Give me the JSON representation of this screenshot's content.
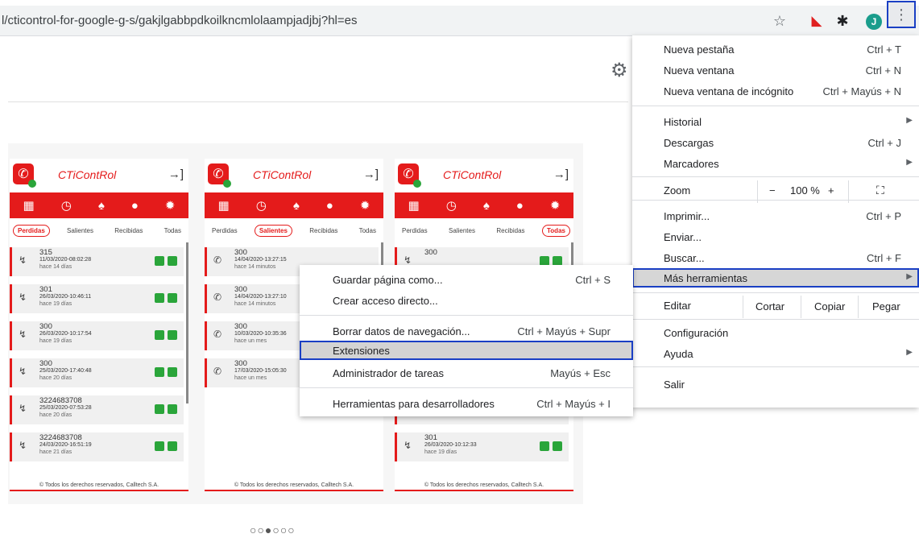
{
  "browser": {
    "url": "l/cticontrol-for-google-g-s/gakjlgabbpdkoilkncmlolaampjadjbj?hl=es",
    "avatar_letter": "J",
    "icons": [
      "star-icon",
      "extension-red-icon",
      "puzzle-icon",
      "avatar",
      "kebab-menu-icon"
    ]
  },
  "pagination_dots": "○○●○○○",
  "app": {
    "brand": "CTiContRol",
    "tabs": [
      "Perdidas",
      "Salientes",
      "Recibidas",
      "Todas"
    ],
    "footer": "© Todos los derechos reservados, Calltech S.A."
  },
  "cards": [
    {
      "active_tab": 0,
      "calls": [
        {
          "number": "315",
          "datetime": "11/03/2020-08:02:28",
          "ago": "hace 14 días"
        },
        {
          "number": "301",
          "datetime": "26/03/2020-10:46:11",
          "ago": "hace 19 días"
        },
        {
          "number": "300",
          "datetime": "26/03/2020-10:17:54",
          "ago": "hace 19 días"
        },
        {
          "number": "300",
          "datetime": "25/03/2020-17:40:48",
          "ago": "hace 20 días"
        },
        {
          "number": "3224683708",
          "datetime": "25/03/2020-07:53:28",
          "ago": "hace 20 días"
        },
        {
          "number": "3224683708",
          "datetime": "24/03/2020-16:51:19",
          "ago": "hace 21 días"
        }
      ]
    },
    {
      "active_tab": 1,
      "calls": [
        {
          "number": "300",
          "datetime": "14/04/2020-13:27:15",
          "ago": "hace 14 minutos"
        },
        {
          "number": "300",
          "datetime": "14/04/2020-13:27:10",
          "ago": "hace 14 minutos"
        },
        {
          "number": "300",
          "datetime": "10/03/2020-10:35:36",
          "ago": "hace un mes"
        },
        {
          "number": "300",
          "datetime": "17/03/2020-15:05:30",
          "ago": "hace un mes"
        }
      ]
    },
    {
      "active_tab": 3,
      "calls": [
        {
          "number": "300",
          "datetime": "",
          "ago": ""
        },
        {
          "number": "",
          "datetime": "",
          "ago": ""
        },
        {
          "number": "",
          "datetime": "",
          "ago": ""
        },
        {
          "number": "",
          "datetime": "",
          "ago": ""
        },
        {
          "number": "300",
          "datetime": "26/03/2020-10:17:54",
          "ago": "hace 19 días"
        },
        {
          "number": "301",
          "datetime": "26/03/2020-10:12:33",
          "ago": "hace 19 días"
        }
      ]
    }
  ],
  "main_menu": {
    "new_tab": {
      "label": "Nueva pestaña",
      "shortcut": "Ctrl + T"
    },
    "new_window": {
      "label": "Nueva ventana",
      "shortcut": "Ctrl + N"
    },
    "incognito": {
      "label": "Nueva ventana de incógnito",
      "shortcut": "Ctrl + Mayús + N"
    },
    "history": {
      "label": "Historial"
    },
    "downloads": {
      "label": "Descargas",
      "shortcut": "Ctrl + J"
    },
    "bookmarks": {
      "label": "Marcadores"
    },
    "zoom": {
      "label": "Zoom",
      "minus": "−",
      "value": "100 %",
      "plus": "+"
    },
    "print": {
      "label": "Imprimir...",
      "shortcut": "Ctrl + P"
    },
    "cast": {
      "label": "Enviar..."
    },
    "find": {
      "label": "Buscar...",
      "shortcut": "Ctrl + F"
    },
    "more_tools": {
      "label": "Más herramientas"
    },
    "edit": {
      "label": "Editar",
      "cut": "Cortar",
      "copy": "Copiar",
      "paste": "Pegar"
    },
    "settings": {
      "label": "Configuración"
    },
    "help": {
      "label": "Ayuda"
    },
    "exit": {
      "label": "Salir"
    }
  },
  "sub_menu": {
    "save_page": {
      "label": "Guardar página como...",
      "shortcut": "Ctrl + S"
    },
    "create_shortcut": {
      "label": "Crear acceso directo..."
    },
    "clear_data": {
      "label": "Borrar datos de navegación...",
      "shortcut": "Ctrl + Mayús + Supr"
    },
    "extensions": {
      "label": "Extensiones"
    },
    "task_manager": {
      "label": "Administrador de tareas",
      "shortcut": "Mayús + Esc"
    },
    "dev_tools": {
      "label": "Herramientas para desarrolladores",
      "shortcut": "Ctrl + Mayús + I"
    }
  },
  "colors": {
    "accent_red": "#e41b1b",
    "highlight_border": "#1a3fc4",
    "call_green": "#2aa53a"
  }
}
